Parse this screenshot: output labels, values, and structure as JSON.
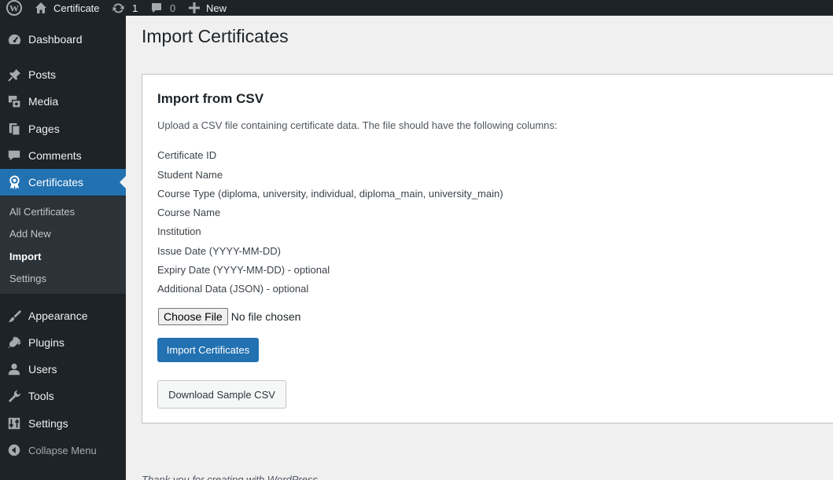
{
  "admin_bar": {
    "site_name": "Certificate",
    "updates_count": "1",
    "comments_count": "0",
    "new_label": "New"
  },
  "sidebar": {
    "items": [
      {
        "label": "Dashboard",
        "icon": "dashboard-icon"
      },
      {
        "label": "Posts",
        "icon": "pin-icon"
      },
      {
        "label": "Media",
        "icon": "media-icon"
      },
      {
        "label": "Pages",
        "icon": "pages-icon"
      },
      {
        "label": "Comments",
        "icon": "comments-icon"
      },
      {
        "label": "Certificates",
        "icon": "award-icon"
      },
      {
        "label": "Appearance",
        "icon": "brush-icon"
      },
      {
        "label": "Plugins",
        "icon": "plugin-icon"
      },
      {
        "label": "Users",
        "icon": "user-icon"
      },
      {
        "label": "Tools",
        "icon": "wrench-icon"
      },
      {
        "label": "Settings",
        "icon": "sliders-icon"
      }
    ],
    "submenu": [
      "All Certificates",
      "Add New",
      "Import",
      "Settings"
    ],
    "collapse_label": "Collapse Menu",
    "accent_color": "#2271b1"
  },
  "main": {
    "page_title": "Import Certificates",
    "section_title": "Import from CSV",
    "intro": "Upload a CSV file containing certificate data. The file should have the following columns:",
    "columns": [
      "Certificate ID",
      "Student Name",
      "Course Type (diploma, university, individual, diploma_main, university_main)",
      "Course Name",
      "Institution",
      "Issue Date (YYYY-MM-DD)",
      "Expiry Date (YYYY-MM-DD) - optional",
      "Additional Data (JSON) - optional"
    ],
    "file_button": "Choose File",
    "file_status": "No file chosen",
    "import_button": "Import Certificates",
    "download_button": "Download Sample CSV"
  },
  "footer": {
    "text": "Thank you for creating with WordPress."
  }
}
